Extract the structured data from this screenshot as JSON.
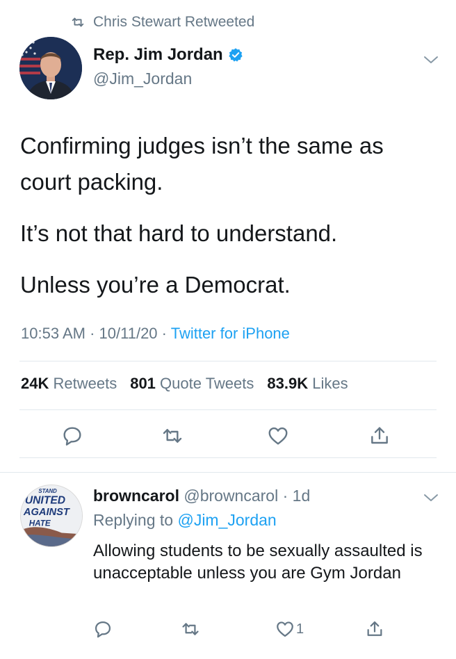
{
  "retweet_context": {
    "label": "Chris Stewart Retweeted",
    "icon": "retweet-icon"
  },
  "tweet": {
    "author_name": "Rep. Jim Jordan",
    "author_handle": "@Jim_Jordan",
    "verified": true,
    "text_paragraphs": [
      "Confirming judges isn’t the same as court packing.",
      "It’s not that hard to understand.",
      "Unless you’re a Democrat."
    ],
    "time": "10:53 AM",
    "date": "10/11/20",
    "separator": "·",
    "source": "Twitter for iPhone",
    "stats": {
      "retweets_count": "24K",
      "retweets_label": "Retweets",
      "quote_count": "801",
      "quote_label": "Quote Tweets",
      "likes_count": "83.9K",
      "likes_label": "Likes"
    },
    "actions": [
      "reply-icon",
      "retweet-icon",
      "like-icon",
      "share-icon"
    ]
  },
  "reply": {
    "author_name": "browncarol",
    "author_handle": "@browncarol",
    "separator": "·",
    "age": "1d",
    "replying_prefix": "Replying to",
    "replying_to": "@Jim_Jordan",
    "text": "Allowing students to be sexually assaulted is unacceptable unless you are Gym Jordan",
    "like_count": "1",
    "avatar_sign_lines": [
      "STAND",
      "UNITED",
      "AGAINST",
      "HATE"
    ]
  },
  "colors": {
    "text": "#14171a",
    "secondary": "#657786",
    "link": "#1da1f2",
    "divider": "#e1e8ed"
  }
}
